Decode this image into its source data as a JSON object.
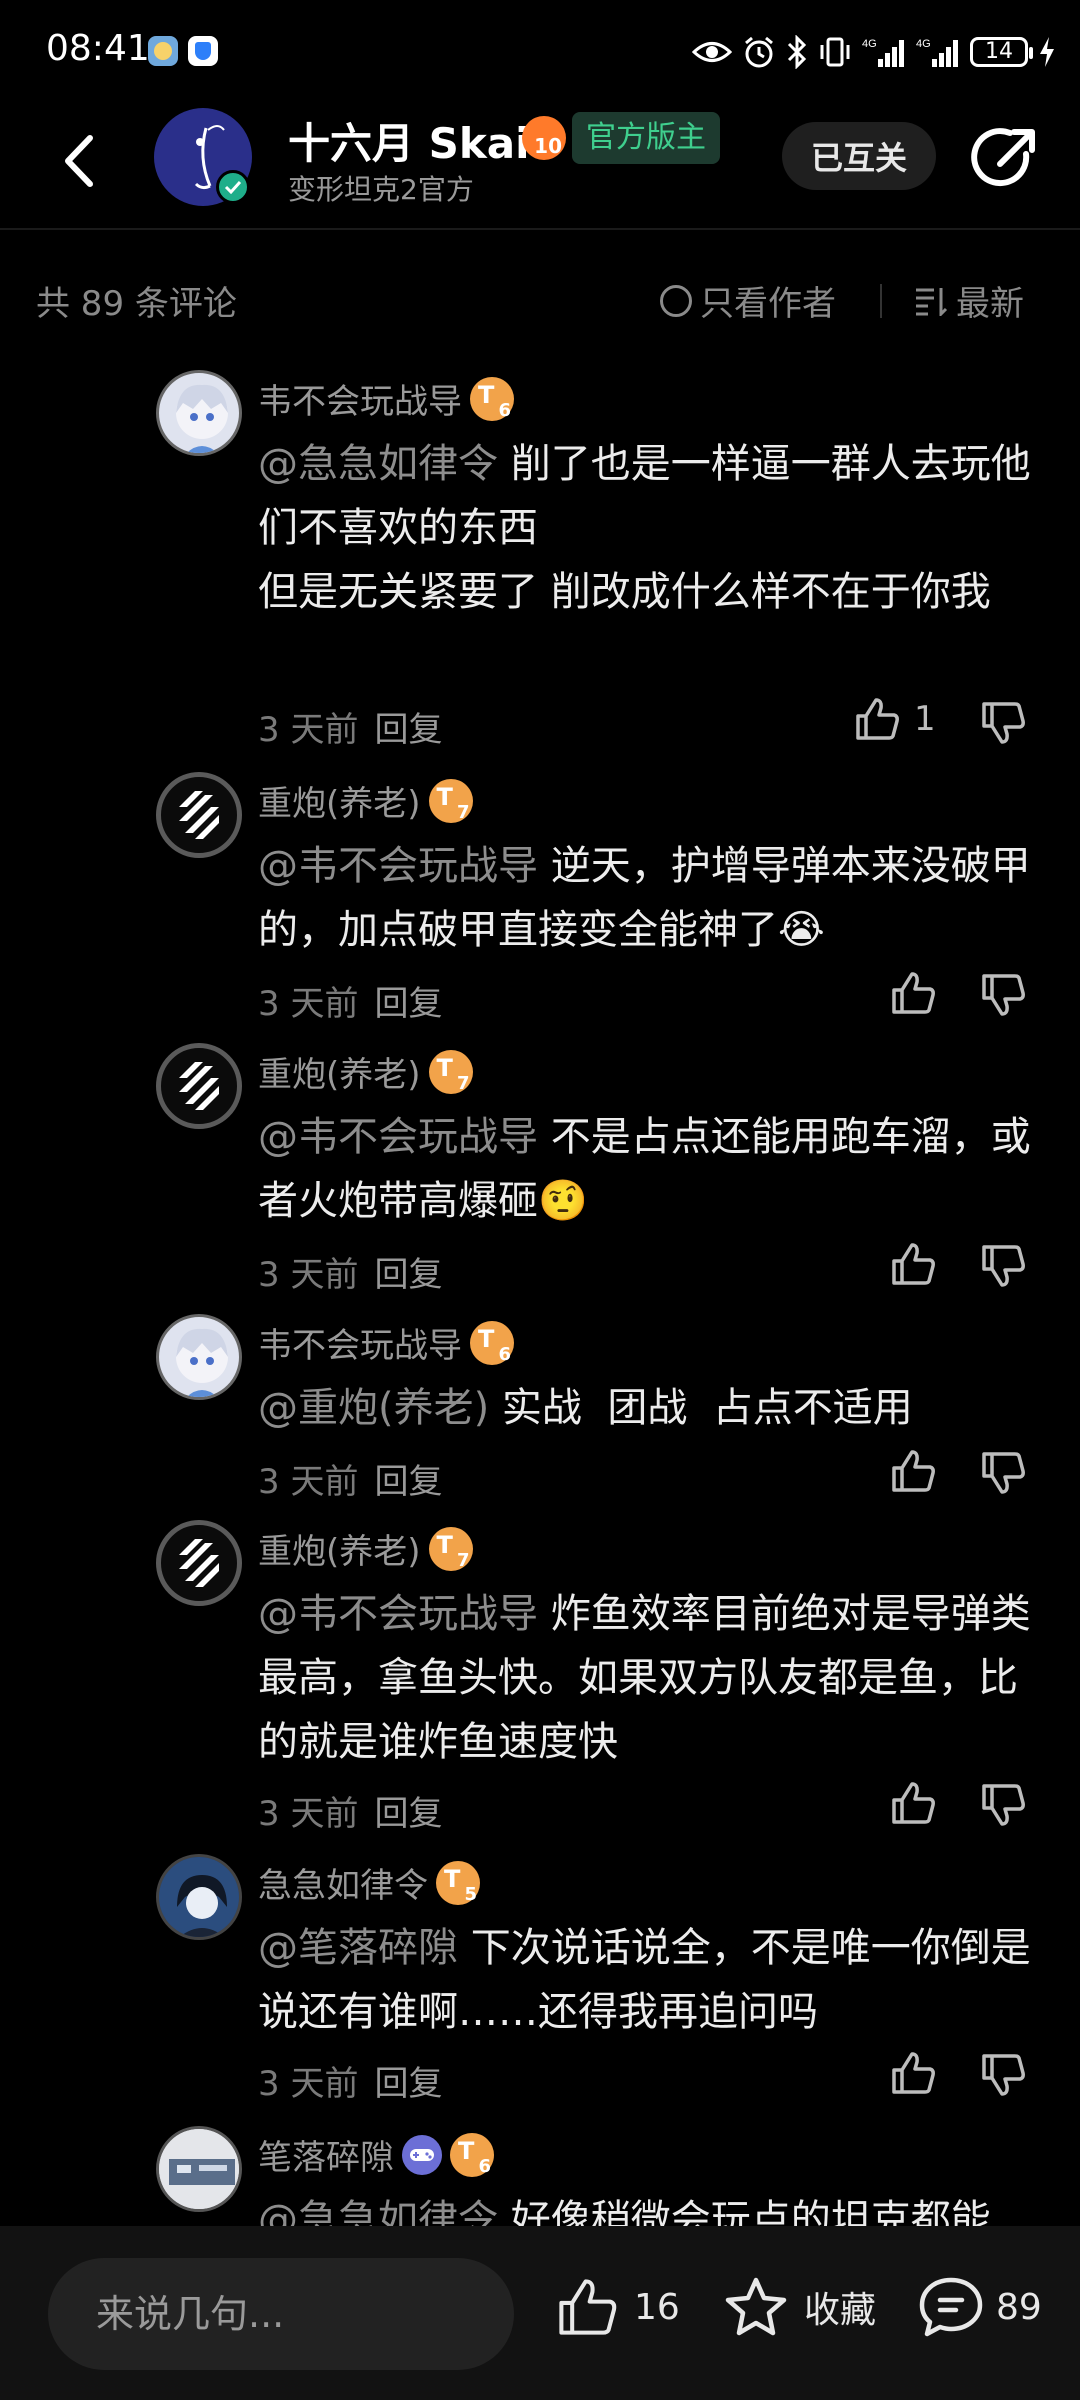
{
  "status_bar": {
    "time": "08:41",
    "battery": "14",
    "net1": "4G",
    "net2": "4G"
  },
  "header": {
    "name": "十六月 Skai",
    "level": "10",
    "tag": "官方版主",
    "subtitle": "变形坦克2官方",
    "mutual_label": "已互关"
  },
  "comments_bar": {
    "count_label": "共 89 条评论",
    "only_author_label": "只看作者",
    "sort_label": "最新"
  },
  "comments": [
    {
      "user": "韦不会玩战导",
      "level": "6",
      "mention": "@急急如律令",
      "text": " 削了也是一样逼一群人去玩他们不喜欢的东西\n但是无关紧要了 削改成什么样不在于你我",
      "time": "3 天前",
      "reply": "回复",
      "likes": "1"
    },
    {
      "user": "重炮(养老)",
      "level": "7",
      "mention": "@韦不会玩战导",
      "text": " 逆天，护增导弹本来没破甲的，加点破甲直接变全能神了😭",
      "time": "3 天前",
      "reply": "回复",
      "likes": ""
    },
    {
      "user": "重炮(养老)",
      "level": "7",
      "mention": "@韦不会玩战导",
      "text": " 不是占点还能用跑车溜，或者火炮带高爆砸🤨",
      "time": "3 天前",
      "reply": "回复",
      "likes": ""
    },
    {
      "user": "韦不会玩战导",
      "level": "6",
      "mention": "@重炮(养老)",
      "text": " 实战  团战  占点不适用",
      "time": "3 天前",
      "reply": "回复",
      "likes": ""
    },
    {
      "user": "重炮(养老)",
      "level": "7",
      "mention": "@韦不会玩战导",
      "text": " 炸鱼效率目前绝对是导弹类最高，拿鱼头快。如果双方队友都是鱼，比的就是谁炸鱼速度快",
      "time": "3 天前",
      "reply": "回复",
      "likes": ""
    },
    {
      "user": "急急如律令",
      "level": "5",
      "mention": "@笔落碎隙",
      "text": " 下次说话说全，不是唯一你倒是说还有谁啊……还得我再追问吗",
      "time": "3 天前",
      "reply": "回复",
      "likes": ""
    },
    {
      "user": "笔落碎隙",
      "level": "6",
      "mention": "@急急如律令",
      "text": " 好像稍微会玩点的坦克都能",
      "time": "",
      "reply": "",
      "likes": ""
    }
  ],
  "bottom_bar": {
    "input_placeholder": "来说几句...",
    "like_count": "16",
    "fav_label": "收藏",
    "comment_count": "89"
  },
  "colors": {
    "background": "#000000",
    "accent_green": "#3fcf8e",
    "level_orange": "#f2a34a",
    "muted": "#9a9a9a"
  }
}
